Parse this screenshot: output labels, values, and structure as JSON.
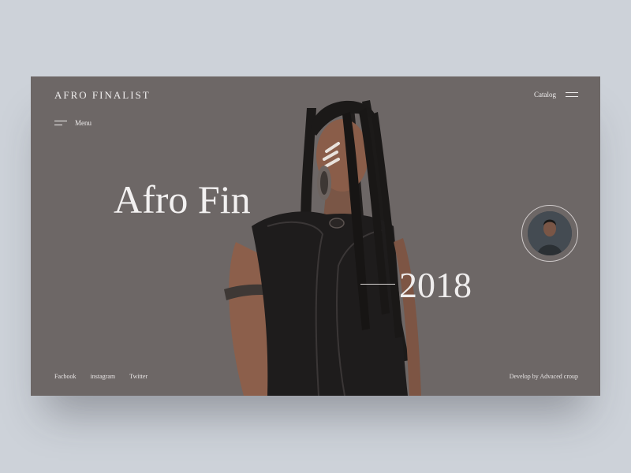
{
  "header": {
    "brand": "AFRO FINALIST",
    "menu_label": "Menu",
    "catalog_label": "Catalog"
  },
  "hero": {
    "title": "Afro Fin",
    "year": "2018"
  },
  "footer": {
    "links": [
      "Facbook",
      "instagram",
      "Twitter"
    ],
    "credit": "Develop by Advaced croup"
  },
  "colors": {
    "background": "#cdd2d9",
    "card": "#6d6766",
    "text": "#f0eeee"
  }
}
